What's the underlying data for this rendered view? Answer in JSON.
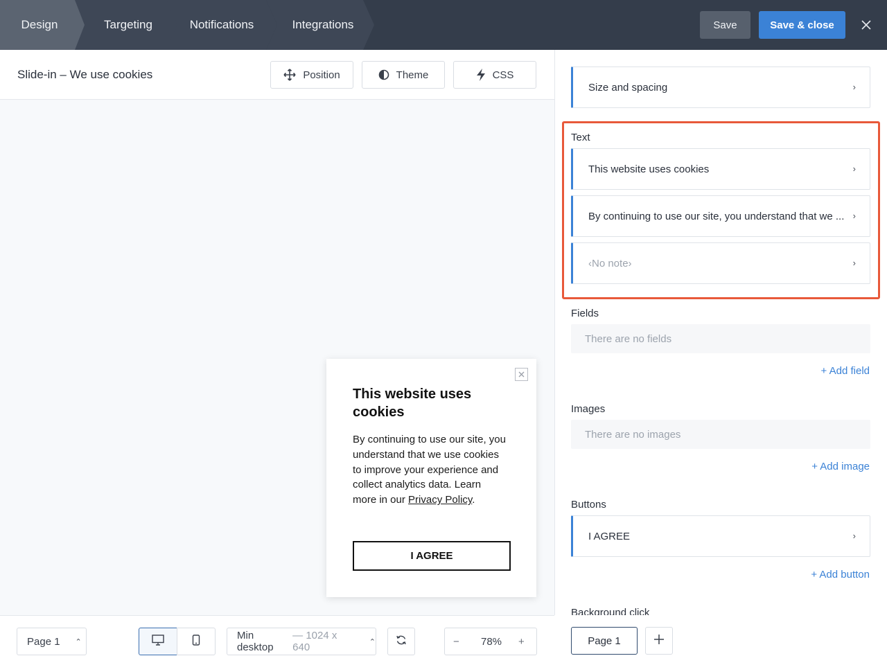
{
  "topbar": {
    "tabs": [
      {
        "label": "Design"
      },
      {
        "label": "Targeting"
      },
      {
        "label": "Notifications"
      },
      {
        "label": "Integrations"
      }
    ],
    "save_label": "Save",
    "save_close_label": "Save & close",
    "close_icon": "close-icon"
  },
  "editor": {
    "title": "Slide-in – We use cookies",
    "tools": [
      {
        "label": "Position",
        "icon": "move-icon"
      },
      {
        "label": "Theme",
        "icon": "contrast-icon"
      },
      {
        "label": "CSS",
        "icon": "lightning-icon"
      }
    ]
  },
  "popup": {
    "title": "This website uses cookies",
    "body_text": "By continuing to use our site, you understand that we use cookies to improve your experience and collect analytics data. Learn more in our ",
    "link_text": "Privacy Policy",
    "body_end": ".",
    "button_label": "I AGREE"
  },
  "footer": {
    "page_select": "Page 1",
    "viewport_label": "Min desktop",
    "viewport_size": "— 1024 x 640",
    "zoom": "78%",
    "zoom_minus": "−",
    "zoom_plus": "+"
  },
  "panel": {
    "size_spacing": "Size and spacing",
    "text_section": "Text",
    "text_items": [
      "This website uses cookies",
      "By continuing to use our site, you understand that we ...",
      "‹No note›"
    ],
    "fields_section": "Fields",
    "fields_empty": "There are no fields",
    "add_field": "+ Add field",
    "images_section": "Images",
    "images_empty": "There are no images",
    "add_image": "+ Add image",
    "buttons_section": "Buttons",
    "buttons_items": [
      "I AGREE"
    ],
    "add_button": "+ Add button",
    "background_section": "Background click",
    "page_tab": "Page 1",
    "page_add": "+"
  },
  "colors": {
    "accent": "#3b82d6",
    "topbar": "#343d4b",
    "highlight": "#e8593a"
  }
}
